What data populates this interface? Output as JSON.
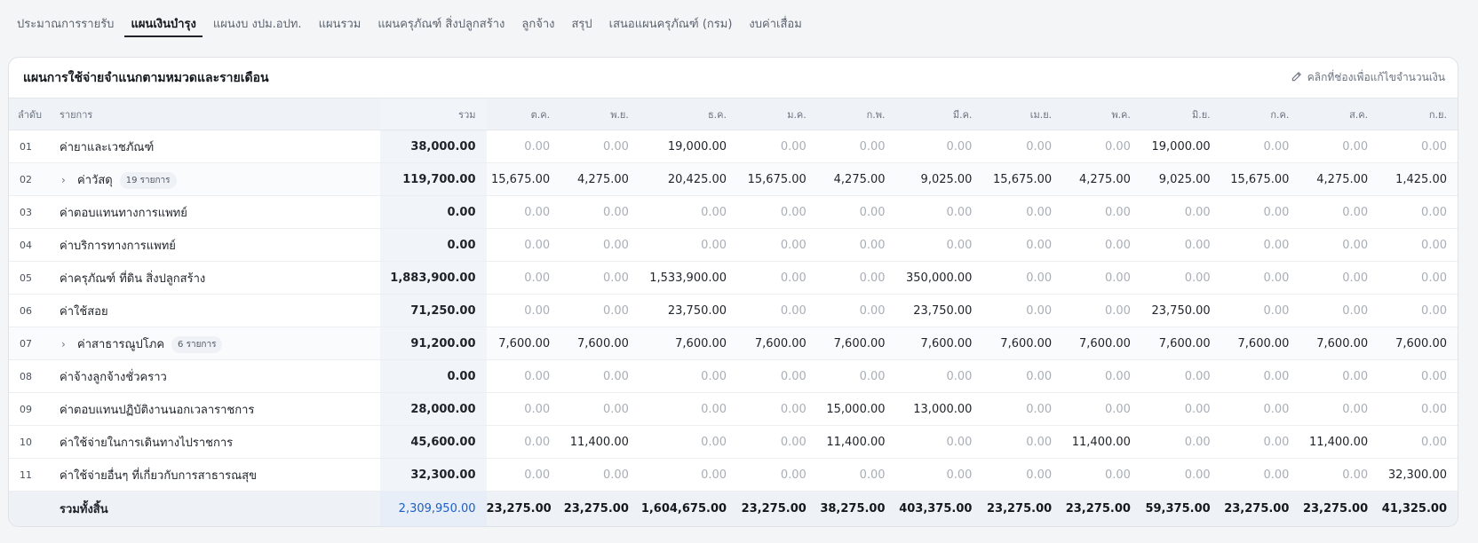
{
  "tabs": [
    {
      "label": "ประมาณการรายรับ",
      "active": false
    },
    {
      "label": "แผนเงินบำรุง",
      "active": true
    },
    {
      "label": "แผนงบ งปม.อปท.",
      "active": false
    },
    {
      "label": "แผนรวม",
      "active": false
    },
    {
      "label": "แผนครุภัณฑ์ สิ่งปลูกสร้าง",
      "active": false
    },
    {
      "label": "ลูกจ้าง",
      "active": false
    },
    {
      "label": "สรุป",
      "active": false
    },
    {
      "label": "เสนอแผนครุภัณฑ์ (กรม)",
      "active": false
    },
    {
      "label": "งบค่าเสื่อม",
      "active": false
    }
  ],
  "card": {
    "title": "แผนการใช้จ่ายจำแนกตามหมวดและรายเดือน",
    "hint": "คลิกที่ช่องเพื่อแก้ไขจำนวนเงิน",
    "hint_icon": "pencil-icon"
  },
  "table": {
    "headers": {
      "index": "ลำดับ",
      "item": "รายการ",
      "total": "รวม",
      "months": [
        "ต.ค.",
        "พ.ย.",
        "ธ.ค.",
        "ม.ค.",
        "ก.พ.",
        "มี.ค.",
        "เม.ย.",
        "พ.ค.",
        "มิ.ย.",
        "ก.ค.",
        "ส.ค.",
        "ก.ย."
      ]
    },
    "rows": [
      {
        "index": "01",
        "name": "ค่ายาและเวชภัณฑ์",
        "expandable": false,
        "badge": "",
        "total": "38,000.00",
        "months": [
          "0.00",
          "0.00",
          "19,000.00",
          "0.00",
          "0.00",
          "0.00",
          "0.00",
          "0.00",
          "19,000.00",
          "0.00",
          "0.00",
          "0.00"
        ]
      },
      {
        "index": "02",
        "name": "ค่าวัสดุ",
        "expandable": true,
        "badge": "19 รายการ",
        "total": "119,700.00",
        "months": [
          "15,675.00",
          "4,275.00",
          "20,425.00",
          "15,675.00",
          "4,275.00",
          "9,025.00",
          "15,675.00",
          "4,275.00",
          "9,025.00",
          "15,675.00",
          "4,275.00",
          "1,425.00"
        ]
      },
      {
        "index": "03",
        "name": "ค่าตอบแทนทางการแพทย์",
        "expandable": false,
        "badge": "",
        "total": "0.00",
        "months": [
          "0.00",
          "0.00",
          "0.00",
          "0.00",
          "0.00",
          "0.00",
          "0.00",
          "0.00",
          "0.00",
          "0.00",
          "0.00",
          "0.00"
        ]
      },
      {
        "index": "04",
        "name": "ค่าบริการทางการแพทย์",
        "expandable": false,
        "badge": "",
        "total": "0.00",
        "months": [
          "0.00",
          "0.00",
          "0.00",
          "0.00",
          "0.00",
          "0.00",
          "0.00",
          "0.00",
          "0.00",
          "0.00",
          "0.00",
          "0.00"
        ]
      },
      {
        "index": "05",
        "name": "ค่าครุภัณฑ์ ที่ดิน สิ่งปลูกสร้าง",
        "expandable": false,
        "badge": "",
        "total": "1,883,900.00",
        "months": [
          "0.00",
          "0.00",
          "1,533,900.00",
          "0.00",
          "0.00",
          "350,000.00",
          "0.00",
          "0.00",
          "0.00",
          "0.00",
          "0.00",
          "0.00"
        ]
      },
      {
        "index": "06",
        "name": "ค่าใช้สอย",
        "expandable": false,
        "badge": "",
        "total": "71,250.00",
        "months": [
          "0.00",
          "0.00",
          "23,750.00",
          "0.00",
          "0.00",
          "23,750.00",
          "0.00",
          "0.00",
          "23,750.00",
          "0.00",
          "0.00",
          "0.00"
        ]
      },
      {
        "index": "07",
        "name": "ค่าสาธารณูปโภค",
        "expandable": true,
        "badge": "6 รายการ",
        "total": "91,200.00",
        "months": [
          "7,600.00",
          "7,600.00",
          "7,600.00",
          "7,600.00",
          "7,600.00",
          "7,600.00",
          "7,600.00",
          "7,600.00",
          "7,600.00",
          "7,600.00",
          "7,600.00",
          "7,600.00"
        ]
      },
      {
        "index": "08",
        "name": "ค่าจ้างลูกจ้างชั่วคราว",
        "expandable": false,
        "badge": "",
        "total": "0.00",
        "months": [
          "0.00",
          "0.00",
          "0.00",
          "0.00",
          "0.00",
          "0.00",
          "0.00",
          "0.00",
          "0.00",
          "0.00",
          "0.00",
          "0.00"
        ]
      },
      {
        "index": "09",
        "name": "ค่าตอบแทนปฏิบัติงานนอกเวลาราชการ",
        "expandable": false,
        "badge": "",
        "total": "28,000.00",
        "months": [
          "0.00",
          "0.00",
          "0.00",
          "0.00",
          "15,000.00",
          "13,000.00",
          "0.00",
          "0.00",
          "0.00",
          "0.00",
          "0.00",
          "0.00"
        ]
      },
      {
        "index": "10",
        "name": "ค่าใช้จ่ายในการเดินทางไปราชการ",
        "expandable": false,
        "badge": "",
        "total": "45,600.00",
        "months": [
          "0.00",
          "11,400.00",
          "0.00",
          "0.00",
          "11,400.00",
          "0.00",
          "0.00",
          "11,400.00",
          "0.00",
          "0.00",
          "11,400.00",
          "0.00"
        ]
      },
      {
        "index": "11",
        "name": "ค่าใช้จ่ายอื่นๆ ที่เกี่ยวกับการสาธารณสุข",
        "expandable": false,
        "badge": "",
        "total": "32,300.00",
        "months": [
          "0.00",
          "0.00",
          "0.00",
          "0.00",
          "0.00",
          "0.00",
          "0.00",
          "0.00",
          "0.00",
          "0.00",
          "0.00",
          "32,300.00"
        ]
      }
    ],
    "footer": {
      "label": "รวมทั้งสิ้น",
      "total": "2,309,950.00",
      "months": [
        "23,275.00",
        "23,275.00",
        "1,604,675.00",
        "23,275.00",
        "38,275.00",
        "403,375.00",
        "23,275.00",
        "23,275.00",
        "59,375.00",
        "23,275.00",
        "23,275.00",
        "41,325.00"
      ]
    }
  },
  "colors": {
    "grand_total": "#1d5fc2",
    "zero_value": "#a9aeb6",
    "header_bg": "#eff2f6"
  }
}
